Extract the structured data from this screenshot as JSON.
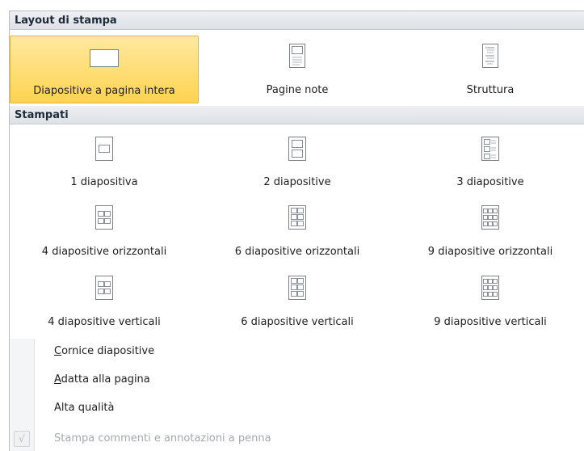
{
  "layout_section": {
    "title": "Layout di stampa",
    "items": [
      {
        "label": "Diapositive a pagina intera",
        "icon": "full-page-slide-icon",
        "selected": true
      },
      {
        "label": "Pagine note",
        "icon": "notes-page-icon",
        "selected": false
      },
      {
        "label": "Struttura",
        "icon": "outline-icon",
        "selected": false
      }
    ]
  },
  "handouts_section": {
    "title": "Stampati",
    "items": [
      {
        "label": "1 diapositiva",
        "icon": "handout-1-icon"
      },
      {
        "label": "2 diapositive",
        "icon": "handout-2-icon"
      },
      {
        "label": "3 diapositive",
        "icon": "handout-3-icon"
      },
      {
        "label": "4 diapositive orizzontali",
        "icon": "handout-4-horizontal-icon"
      },
      {
        "label": "6 diapositive orizzontali",
        "icon": "handout-6-horizontal-icon"
      },
      {
        "label": "9 diapositive orizzontali",
        "icon": "handout-9-horizontal-icon"
      },
      {
        "label": "4 diapositive verticali",
        "icon": "handout-4-vertical-icon"
      },
      {
        "label": "6 diapositive verticali",
        "icon": "handout-6-vertical-icon"
      },
      {
        "label": "9 diapositive verticali",
        "icon": "handout-9-vertical-icon"
      }
    ]
  },
  "options": [
    {
      "label": "Cornice diapositive",
      "accel": "C",
      "rest": "ornice diapositive",
      "enabled": true,
      "checked": false
    },
    {
      "label": "Adatta alla pagina",
      "accel": "A",
      "rest": "datta alla pagina",
      "enabled": true,
      "checked": false
    },
    {
      "label": "Alta qualità",
      "accel": "",
      "rest": "Alta qualità",
      "enabled": true,
      "checked": false
    },
    {
      "label": "Stampa commenti e annotazioni a penna",
      "accel": "",
      "rest": "Stampa commenti e annotazioni a penna",
      "enabled": false,
      "checked": true
    }
  ],
  "check_glyph": "√",
  "colors": {
    "selected_fill": "#ffd34f",
    "selected_border": "#e3b43a",
    "header_bg": "#dde0e5",
    "disabled_text": "#a5a8ad"
  }
}
